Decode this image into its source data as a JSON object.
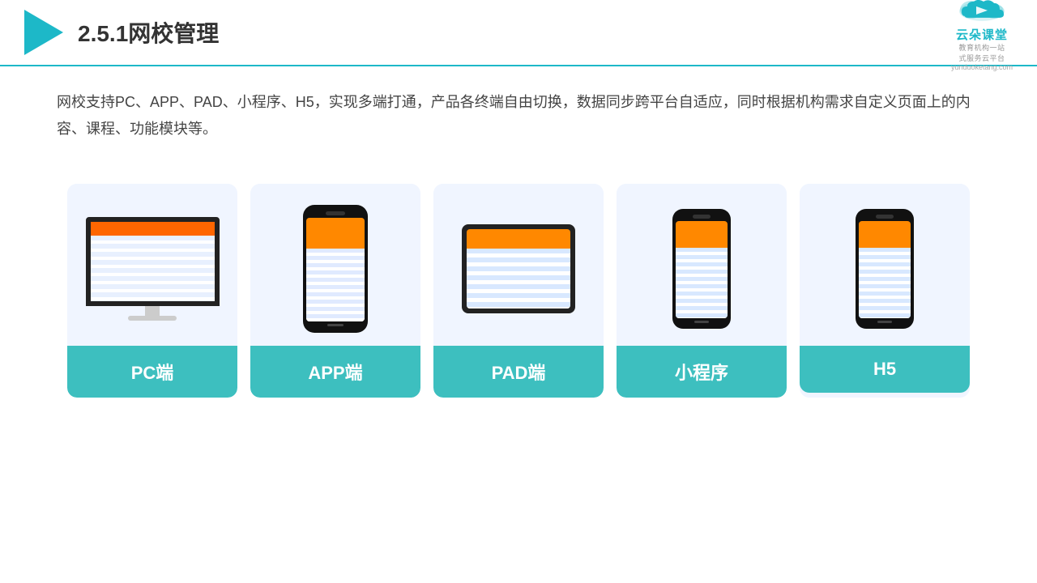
{
  "header": {
    "title": "2.5.1网校管理",
    "brand_name": "云朵课堂",
    "brand_url": "yunduoketang.com",
    "brand_sub": "教育机构一站\n式服务云平台"
  },
  "description": {
    "text": "网校支持PC、APP、PAD、小程序、H5，实现多端打通，产品各终端自由切换，数据同步跨平台自适应，同时根据机构需求自定义页面上的内容、课程、功能模块等。"
  },
  "cards": [
    {
      "id": "pc",
      "label": "PC端",
      "device": "monitor"
    },
    {
      "id": "app",
      "label": "APP端",
      "device": "phone"
    },
    {
      "id": "pad",
      "label": "PAD端",
      "device": "tablet"
    },
    {
      "id": "mini",
      "label": "小程序",
      "device": "phone-small"
    },
    {
      "id": "h5",
      "label": "H5",
      "device": "phone-small"
    }
  ],
  "accent_color": "#3dbfbf"
}
